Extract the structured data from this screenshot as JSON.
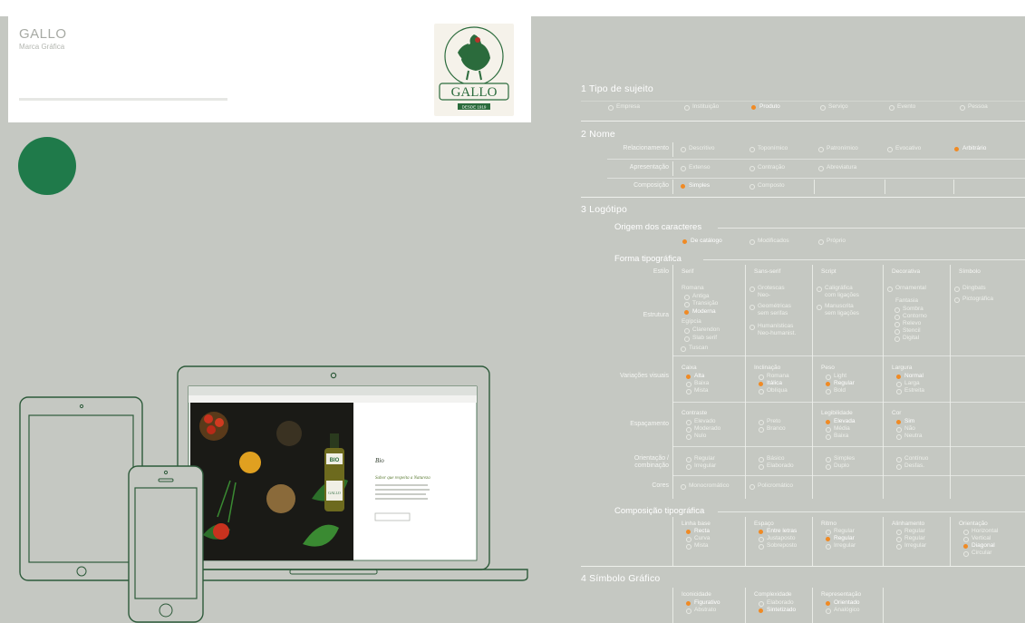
{
  "header": {
    "title": "GALLO",
    "subtitle": "Marca Gráfica",
    "logo_text": "GALLO",
    "logo_date": "DESDE 1919"
  },
  "colors": {
    "background": "#c5c8c2",
    "brand_green": "#1f7a4a",
    "selected": "#f08a24"
  },
  "sections": {
    "s1": {
      "title": "1  Tipo de sujeito"
    },
    "s2": {
      "title": "2  Nome"
    },
    "s3": {
      "title": "3  Logótipo"
    },
    "s4": {
      "title": "4  Símbolo Gráfico"
    }
  },
  "s2_rows": {
    "r1": {
      "label": "Relacionamento"
    },
    "r2": {
      "label": "Apresentação"
    },
    "r3": {
      "label": "Composição"
    }
  },
  "s3_subs": {
    "origem": "Origem dos caracteres",
    "forma": "Forma tipográfica",
    "composicao": "Composição tipográfica"
  },
  "s3_rows": {
    "estilo": "Estilo",
    "estrutura": "Estrutura",
    "variacoes": "Variações visuais",
    "espacamento": "Espaçamento",
    "relacao": "Orientação / combinação",
    "cores": "Cores"
  },
  "laptop_page": {
    "heading": "Bio",
    "subheading": "Sabor que respeita a Natureza",
    "bottle_label": "BIO",
    "bottle_brand": "GALLO"
  }
}
